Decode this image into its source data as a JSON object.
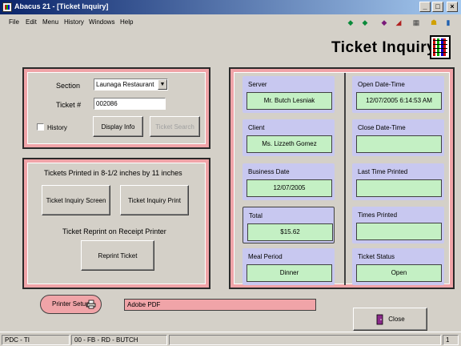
{
  "window": {
    "title": "Abacus 21 - [Ticket Inquiry]"
  },
  "menu": [
    "File",
    "Edit",
    "Menu",
    "History",
    "Windows",
    "Help"
  ],
  "page_title": "Ticket Inquiry",
  "search": {
    "section_label": "Section",
    "section_value": "Launaga Restaurant",
    "ticket_label": "Ticket #",
    "ticket_value": "002086",
    "history_label": "History",
    "display_info_label": "Display Info",
    "ticket_search_label": "Ticket Search"
  },
  "print": {
    "heading": "Tickets Printed in 8-1/2 inches by 11 inches",
    "inquiry_screen_label": "Ticket Inquiry Screen",
    "inquiry_print_label": "Ticket Inquiry Print",
    "receipt_heading": "Ticket Reprint on Receipt Printer",
    "reprint_label": "Reprint Ticket"
  },
  "info": {
    "server_label": "Server",
    "server_value": "Mr. Butch Lesniak",
    "client_label": "Client",
    "client_value": "Ms. Lizzeth Gomez",
    "business_date_label": "Business Date",
    "business_date_value": "12/07/2005",
    "total_label": "Total",
    "total_value": "$15.62",
    "meal_period_label": "Meal Period",
    "meal_period_value": "Dinner",
    "open_dt_label": "Open Date-Time",
    "open_dt_value": "12/07/2005 6:14:53 AM",
    "close_dt_label": "Close Date-Time",
    "close_dt_value": "",
    "last_printed_label": "Last Time Printed",
    "last_printed_value": "",
    "times_printed_label": "Times Printed",
    "times_printed_value": "",
    "status_label": "Ticket Status",
    "status_value": "Open"
  },
  "footer": {
    "printer_setup_label": "Printer Setup",
    "printer_name": "Adobe PDF",
    "close_label": "Close"
  },
  "status": {
    "left": "PDC - TI",
    "user": "00 - FB - RD - BUTCH",
    "right": "1"
  }
}
